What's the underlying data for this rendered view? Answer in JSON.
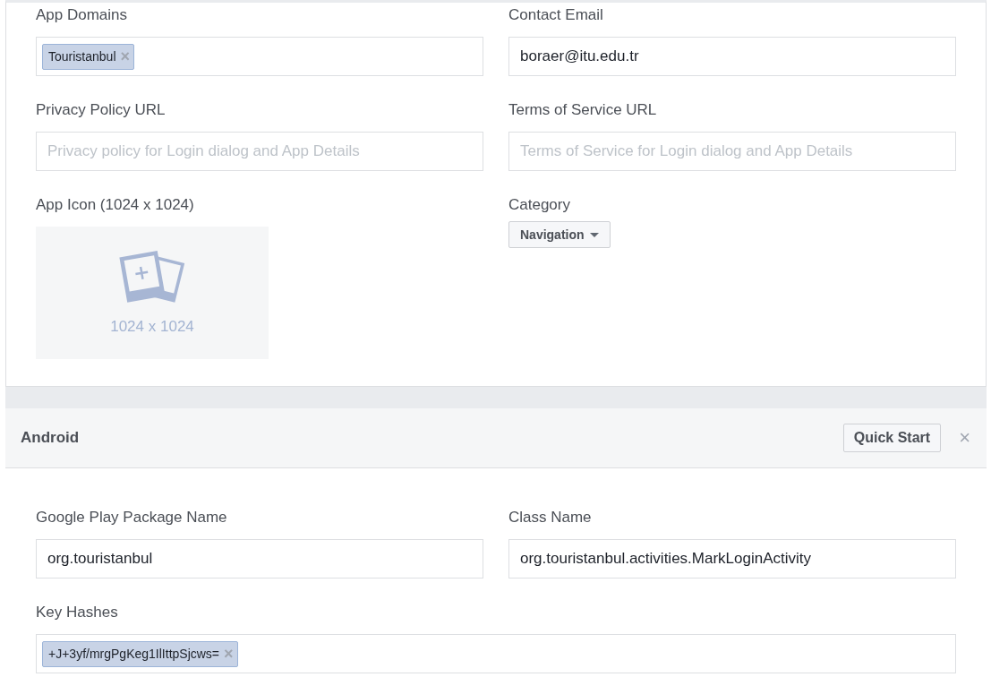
{
  "basic_settings": {
    "fields": [
      {
        "label": "App Domains",
        "kind": "tags",
        "tags": [
          {
            "text": "Touristanbul",
            "remove": "×"
          }
        ]
      },
      {
        "label": "Contact Email",
        "kind": "text",
        "value": "boraer@itu.edu.tr"
      },
      {
        "label": "Privacy Policy URL",
        "kind": "text",
        "placeholder": "Privacy policy for Login dialog and App Details"
      },
      {
        "label": "Terms of Service URL",
        "kind": "text",
        "placeholder": "Terms of Service for Login dialog and App Details"
      },
      {
        "label": "App Icon (1024 x 1024)",
        "kind": "image",
        "caption": "1024 x 1024"
      },
      {
        "label": "Category",
        "kind": "dropdown",
        "value": "Navigation"
      }
    ]
  },
  "android": {
    "title": "Android",
    "button": "Quick Start",
    "close": "×",
    "fields": [
      {
        "label": "Google Play Package Name",
        "kind": "text",
        "value": "org.touristanbul"
      },
      {
        "label": "Class Name",
        "kind": "text",
        "value": "org.touristanbul.activities.MarkLoginActivity"
      },
      {
        "label": "Key Hashes",
        "kind": "tags",
        "tags": [
          {
            "text": "+J+3yf/mrgPgKeg1IlIttpSjcws=",
            "remove": "×"
          }
        ]
      }
    ]
  }
}
